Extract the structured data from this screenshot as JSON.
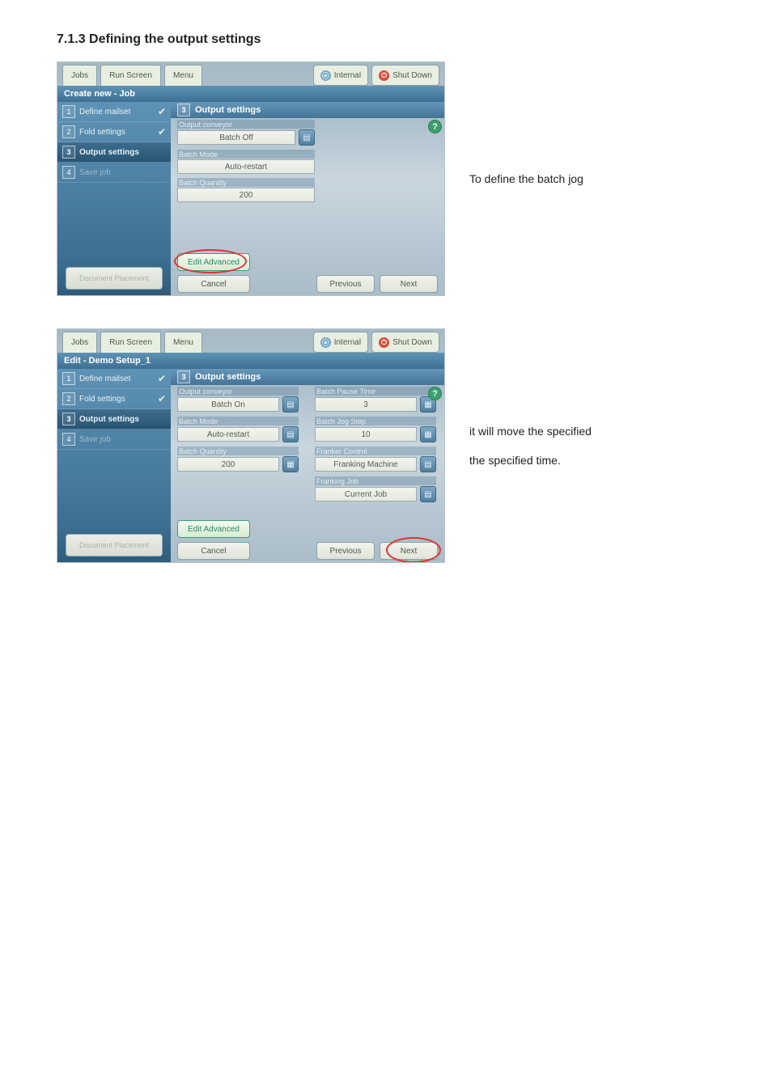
{
  "heading": "7.1.3 Defining the output settings",
  "side_text_1": "To define the batch jog",
  "side_text_2a": "it will move the specified",
  "side_text_2b": "the specified time.",
  "topbar": {
    "jobs": "Jobs",
    "run_screen": "Run Screen",
    "menu": "Menu",
    "internal": "Internal",
    "shut_down": "Shut Down"
  },
  "shot1": {
    "title_bar": "Create new - Job",
    "panel_header": "Output settings",
    "panel_num": "3",
    "steps": [
      {
        "num": "1",
        "label": "Define mailset",
        "done": true
      },
      {
        "num": "2",
        "label": "Fold settings",
        "done": true
      },
      {
        "num": "3",
        "label": "Output settings",
        "active": true
      },
      {
        "num": "4",
        "label": "Save job",
        "disabled": true
      }
    ],
    "fields": {
      "output_conveyor_label": "Output conveyor",
      "output_conveyor_value": "Batch Off",
      "batch_mode_label": "Batch Mode",
      "batch_mode_value": "Auto-restart",
      "batch_quantity_label": "Batch Quantity",
      "batch_quantity_value": "200"
    },
    "doc_placement": "Document Placement",
    "edit_advanced": "Edit Advanced",
    "cancel": "Cancel",
    "previous": "Previous",
    "next": "Next"
  },
  "shot2": {
    "title_bar": "Edit - Demo Setup_1",
    "panel_header": "Output settings",
    "panel_num": "3",
    "steps": [
      {
        "num": "1",
        "label": "Define mailset",
        "done": true
      },
      {
        "num": "2",
        "label": "Fold settings",
        "done": true
      },
      {
        "num": "3",
        "label": "Output settings",
        "active": true
      },
      {
        "num": "4",
        "label": "Save job",
        "disabled": true
      }
    ],
    "left_fields": {
      "output_conveyor_label": "Output conveyor",
      "output_conveyor_value": "Batch On",
      "batch_mode_label": "Batch Mode",
      "batch_mode_value": "Auto-restart",
      "batch_quantity_label": "Batch Quantity",
      "batch_quantity_value": "200"
    },
    "right_fields": {
      "batch_pause_time_label": "Batch Pause Time",
      "batch_pause_time_value": "3",
      "batch_jog_step_label": "Batch Jog Step",
      "batch_jog_step_value": "10",
      "franker_control_label": "Franker Control",
      "franker_control_value": "Franking Machine",
      "franking_job_label": "Franking Job",
      "franking_job_value": "Current Job"
    },
    "doc_placement": "Document Placement",
    "edit_advanced": "Edit Advanced",
    "cancel": "Cancel",
    "previous": "Previous",
    "next": "Next"
  }
}
